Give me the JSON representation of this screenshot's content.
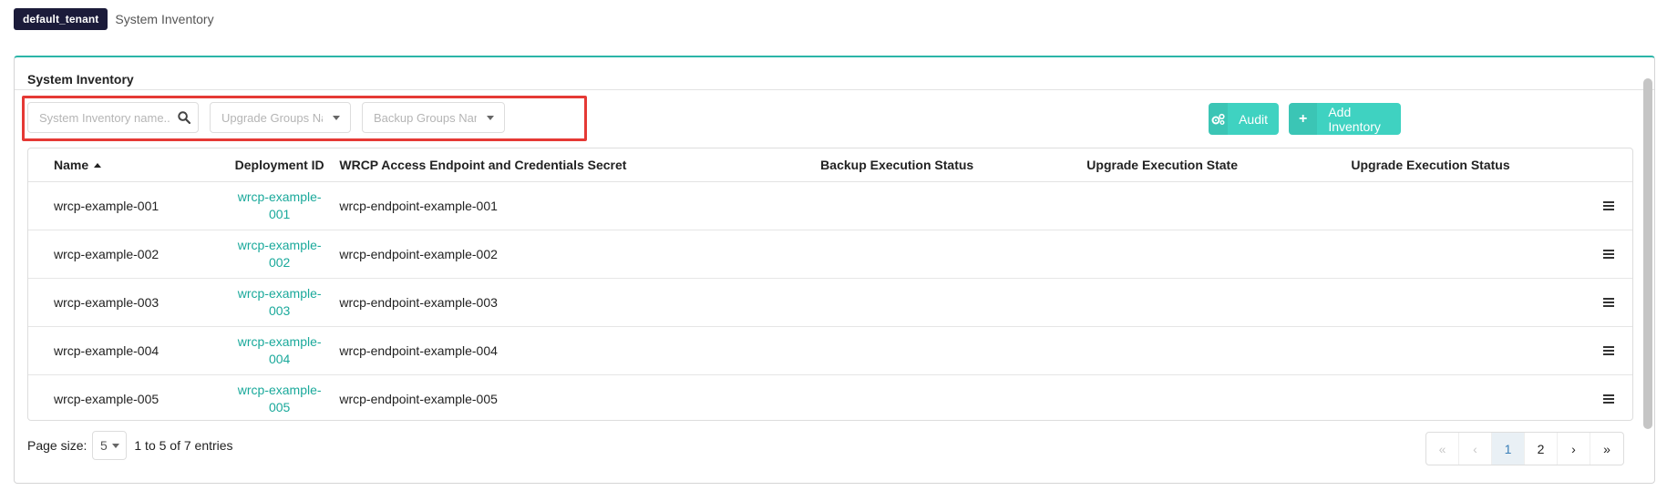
{
  "header": {
    "tenant_badge": "default_tenant",
    "breadcrumb": "System Inventory"
  },
  "panel": {
    "title": "System Inventory"
  },
  "filters": {
    "search_placeholder": "System Inventory name...",
    "upgrade_groups_placeholder": "Upgrade Groups Name",
    "backup_groups_placeholder": "Backup Groups Name"
  },
  "actions": {
    "audit_label": "Audit",
    "add_inventory_label": "Add Inventory"
  },
  "table": {
    "columns": [
      "Name",
      "Deployment ID",
      "WRCP Access Endpoint and Credentials Secret",
      "Backup Execution Status",
      "Upgrade Execution State",
      "Upgrade Execution Status"
    ],
    "rows": [
      {
        "name": "wrcp-example-001",
        "deployment_id_l1": "wrcp-example-",
        "deployment_id_l2": "001",
        "secret": "wrcp-endpoint-example-001",
        "backup_status": "",
        "upgrade_state": "",
        "upgrade_status": ""
      },
      {
        "name": "wrcp-example-002",
        "deployment_id_l1": "wrcp-example-",
        "deployment_id_l2": "002",
        "secret": "wrcp-endpoint-example-002",
        "backup_status": "",
        "upgrade_state": "",
        "upgrade_status": ""
      },
      {
        "name": "wrcp-example-003",
        "deployment_id_l1": "wrcp-example-",
        "deployment_id_l2": "003",
        "secret": "wrcp-endpoint-example-003",
        "backup_status": "",
        "upgrade_state": "",
        "upgrade_status": ""
      },
      {
        "name": "wrcp-example-004",
        "deployment_id_l1": "wrcp-example-",
        "deployment_id_l2": "004",
        "secret": "wrcp-endpoint-example-004",
        "backup_status": "",
        "upgrade_state": "",
        "upgrade_status": ""
      },
      {
        "name": "wrcp-example-005",
        "deployment_id_l1": "wrcp-example-",
        "deployment_id_l2": "005",
        "secret": "wrcp-endpoint-example-005",
        "backup_status": "",
        "upgrade_state": "",
        "upgrade_status": ""
      }
    ]
  },
  "footer": {
    "page_size_label": "Page size:",
    "page_size_value": "5",
    "entries_text": "1 to 5 of 7 entries"
  },
  "pagination": {
    "first": "«",
    "prev": "‹",
    "pages": [
      "1",
      "2"
    ],
    "next": "›",
    "last": "»",
    "current_page": "1"
  },
  "colors": {
    "accent": "#3fd2c1",
    "link": "#1aa99b",
    "highlight_box": "#e53935",
    "tenant_badge_bg": "#1b1b3a"
  },
  "icons": {
    "search": "search-icon",
    "dropdown": "caret-down-icon",
    "audit": "gears-icon",
    "add": "plus-icon",
    "sort": "sort-ascending-icon",
    "row_menu": "hamburger-menu-icon"
  }
}
